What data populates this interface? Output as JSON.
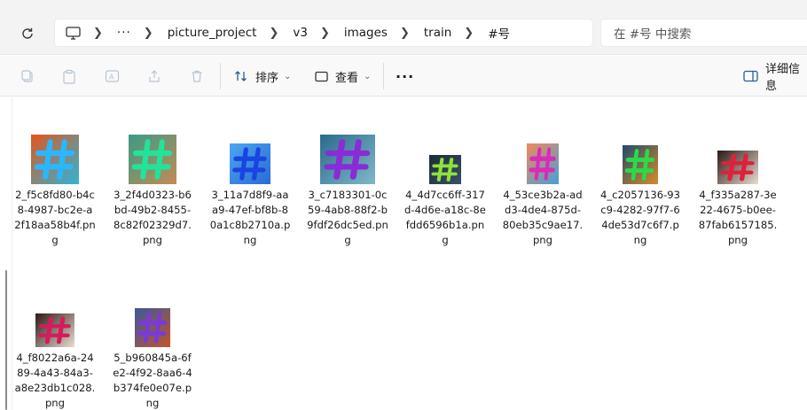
{
  "address_bar": {
    "breadcrumbs": [
      "picture_project",
      "v3",
      "images",
      "train",
      "#号"
    ],
    "overflow_label": "···",
    "search_placeholder": "在 #号 中搜索"
  },
  "toolbar": {
    "sort_label": "排序",
    "view_label": "查看",
    "more_label": "···",
    "details_label": "详细信息"
  },
  "files": [
    {
      "name": "2_f5c8fd80-b4c8-4987-bc2e-a2f18aa58b4f.png",
      "bg1": "#e2561a",
      "bg2": "#2fb4d8",
      "mark": "#2bb7ff"
    },
    {
      "name": "3_2f4d0323-b6bd-49b2-8455-8c82f02329d7.png",
      "bg1": "#3a9a86",
      "bg2": "#c58a55",
      "mark": "#22e39a"
    },
    {
      "name": "3_11a7d8f9-aaa9-47ef-bf8b-80a1c8b2710a.png",
      "bg1": "#4aa7ef",
      "bg2": "#2b6ad6",
      "mark": "#1a44e0"
    },
    {
      "name": "3_c7183301-0c59-4ab8-88f2-b9fdf26dc5ed.png",
      "bg1": "#2a6b8c",
      "bg2": "#7fb8c9",
      "mark": "#8a2bd6"
    },
    {
      "name": "4_4d7cc6ff-317d-4d6e-a18c-8efdd6596b1a.png",
      "bg1": "#1d2a3a",
      "bg2": "#395066",
      "mark": "#8fe23a"
    },
    {
      "name": "4_53ce3b2a-add3-4de4-875d-80eb35c9ae17.png",
      "bg1": "#f08a5a",
      "bg2": "#46a0d6",
      "mark": "#d92bb9"
    },
    {
      "name": "4_c2057136-93c9-4282-97f7-64de53d7c6f7.png",
      "bg1": "#224a6a",
      "bg2": "#d68a2a",
      "mark": "#2bd94a"
    },
    {
      "name": "4_f335a287-3e22-4675-b0ee-87fab6157185.png",
      "bg1": "#2b1a15",
      "bg2": "#e9dcd0",
      "mark": "#e0203a"
    },
    {
      "name": "4_f8022a6a-2489-4a43-84a3-a8e23db1c028.png",
      "bg1": "#2b1a15",
      "bg2": "#e9dcd0",
      "mark": "#d61a5c"
    },
    {
      "name": "5_b960845a-6fe2-4f92-8aa6-4b374fe0e07e.png",
      "bg1": "#3a5a9a",
      "bg2": "#c2552a",
      "mark": "#7a3ad6"
    }
  ]
}
